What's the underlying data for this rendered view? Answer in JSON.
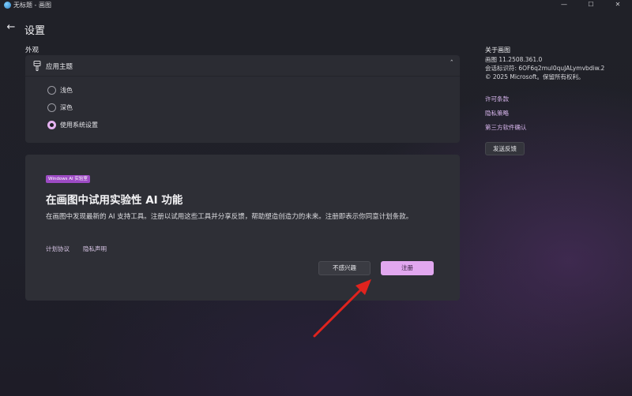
{
  "window": {
    "title": "无标题 - 画图",
    "minimize": "—",
    "maximize": "☐",
    "close": "✕"
  },
  "header": {
    "back": "←",
    "title": "设置"
  },
  "appearance": {
    "section_label": "外观",
    "theme_title": "应用主题",
    "chevron": "ˆ",
    "options": [
      {
        "label": "浅色",
        "selected": false
      },
      {
        "label": "深色",
        "selected": false
      },
      {
        "label": "使用系统设置",
        "selected": true
      }
    ]
  },
  "ai": {
    "badge": "Windows AI 实验室",
    "title": "在画图中试用实验性 AI 功能",
    "description": "在画图中发现最新的 AI 支持工具。注册以试用这些工具并分享反馈，帮助塑造创造力的未来。注册即表示你同意计划条款。",
    "links": [
      "计划协议",
      "隐私声明"
    ],
    "decline_label": "不感兴趣",
    "join_label": "注册"
  },
  "about": {
    "title": "关于画图",
    "version": "画图 11.2508.361.0",
    "session": "会话标识符: 6OF6q2mul0quJALymvbdiw.2",
    "copyright": "© 2025 Microsoft。保留所有权利。",
    "links": [
      "许可条款",
      "隐私策略",
      "第三方软件确认"
    ],
    "feedback_label": "发送反馈"
  },
  "colors": {
    "accent": "#e1a7ef",
    "badge": "#9d4bc4",
    "annotation_arrow": "#e0231e"
  }
}
